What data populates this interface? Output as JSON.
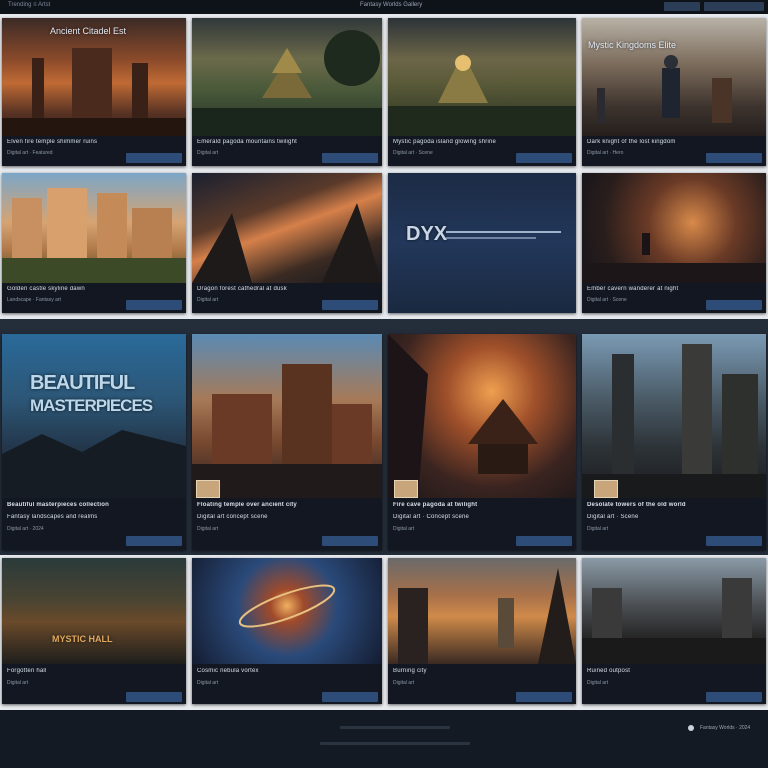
{
  "topbar": {
    "left_text": "Trending  ≡  Artst",
    "center_text": "Fantasy Worlds Gallery"
  },
  "row1": [
    {
      "title": "Elven fire temple shimmer ruins",
      "sub": "Digital art  ·  Featured",
      "overlay": "Ancient Citadel Est"
    },
    {
      "title": "Emerald pagoda mountains twilight",
      "sub": "Digital art",
      "overlay": ""
    },
    {
      "title": "Mystic pagoda island glowing shrine",
      "sub": "Digital art · Scene",
      "overlay": ""
    },
    {
      "title": "Dark knight of the lost kingdom",
      "sub": "Digital art · Hero",
      "overlay": "Mystic Kingdoms Elite"
    }
  ],
  "row2": [
    {
      "title": "Golden castle skyline dawn",
      "sub": "Landscape · Fantasy art",
      "overlay": ""
    },
    {
      "title": "Dragon forest cathedral at dusk",
      "sub": "Digital art",
      "overlay": ""
    },
    {
      "title": "",
      "sub": "",
      "overlay": "DYX"
    },
    {
      "title": "Ember cavern wanderer at night",
      "sub": "Digital art · Scene",
      "overlay": ""
    }
  ],
  "row3": [
    {
      "title": "Beautiful masterpieces collection",
      "sub": "Fantasy landscapes and realms",
      "extra": "Digital art · 2024",
      "overlay_line1": "BEAUTIFUL",
      "overlay_line2": "MASTERPIECES"
    },
    {
      "title": "Floating temple over ancient city",
      "sub": "Digital art concept scene",
      "extra": "Digital art",
      "overlay_line1": "",
      "overlay_line2": ""
    },
    {
      "title": "Fire cave pagoda at twilight",
      "sub": "Digital art · Concept scene",
      "extra": "Digital art",
      "overlay_line1": "",
      "overlay_line2": ""
    },
    {
      "title": "Desolate towers of the old world",
      "sub": "Digital art · Scene",
      "extra": "Digital art",
      "overlay_line1": "",
      "overlay_line2": ""
    }
  ],
  "row4": [
    {
      "title": "Forgotten hall",
      "sub": "Digital art",
      "overlay": "MYSTIC HALL"
    },
    {
      "title": "Cosmic nebula vortex",
      "sub": "Digital art",
      "overlay": ""
    },
    {
      "title": "Burning city",
      "sub": "Digital art",
      "overlay": ""
    },
    {
      "title": "Ruined outpost",
      "sub": "Digital art",
      "overlay": ""
    }
  ],
  "footer": {
    "right_text": "Fantasy Worlds  ·  2024"
  }
}
